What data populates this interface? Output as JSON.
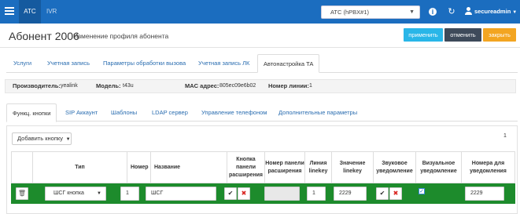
{
  "navbar": {
    "tab_active": "ATC",
    "tab_ivr": "IVR",
    "pbx_select": "АТС (hPBX#1)",
    "username": "secureadmin"
  },
  "page": {
    "title": "Абонент 2006",
    "subtitle": "Изменение профиля абонента"
  },
  "actions": {
    "apply": "применить",
    "cancel": "отменить",
    "close": "закрыть"
  },
  "main_tabs": [
    "Услуги",
    "Учетная запись",
    "Параметры обработки вызова",
    "Учетная запись ЛК",
    "Автонастройка ТА"
  ],
  "info": {
    "manufacturer_label": "Производитель:",
    "manufacturer_value": "yealink",
    "model_label": "Модель:",
    "model_value": "t43u",
    "mac_label": "MAC адрес:",
    "mac_value": "805ec09e6b02",
    "line_label": "Номер линии:",
    "line_value": "1"
  },
  "sub_tabs": [
    "Функц. кнопки",
    "SIP Аккаунт",
    "Шаблоны",
    "LDAP сервер",
    "Управление телефоном",
    "Дополнительные параметры"
  ],
  "panel": {
    "add_button": "Добавить кнопку",
    "pager": "1"
  },
  "table": {
    "headers": [
      "Тип",
      "Номер",
      "Название",
      "Кнопка панели расширения",
      "Номер панели расширения",
      "Линия linekey",
      "Значение linekey",
      "Звуковое уведомление",
      "Визуальное уведомление",
      "Номера для уведомления"
    ],
    "row": {
      "type": "ШСГ кнопка",
      "number": "1",
      "name": "ШСГ",
      "expansion_panel_number": "",
      "line_linekey": "1",
      "value_linekey": "2229",
      "visual_checked": true,
      "notify_numbers": "2229"
    }
  },
  "colors": {
    "navbar": "#1b6dbf",
    "apply": "#29b6e8",
    "cancel": "#3e4a5a",
    "close": "#f3a521",
    "row_highlight": "#1d8b2c"
  }
}
